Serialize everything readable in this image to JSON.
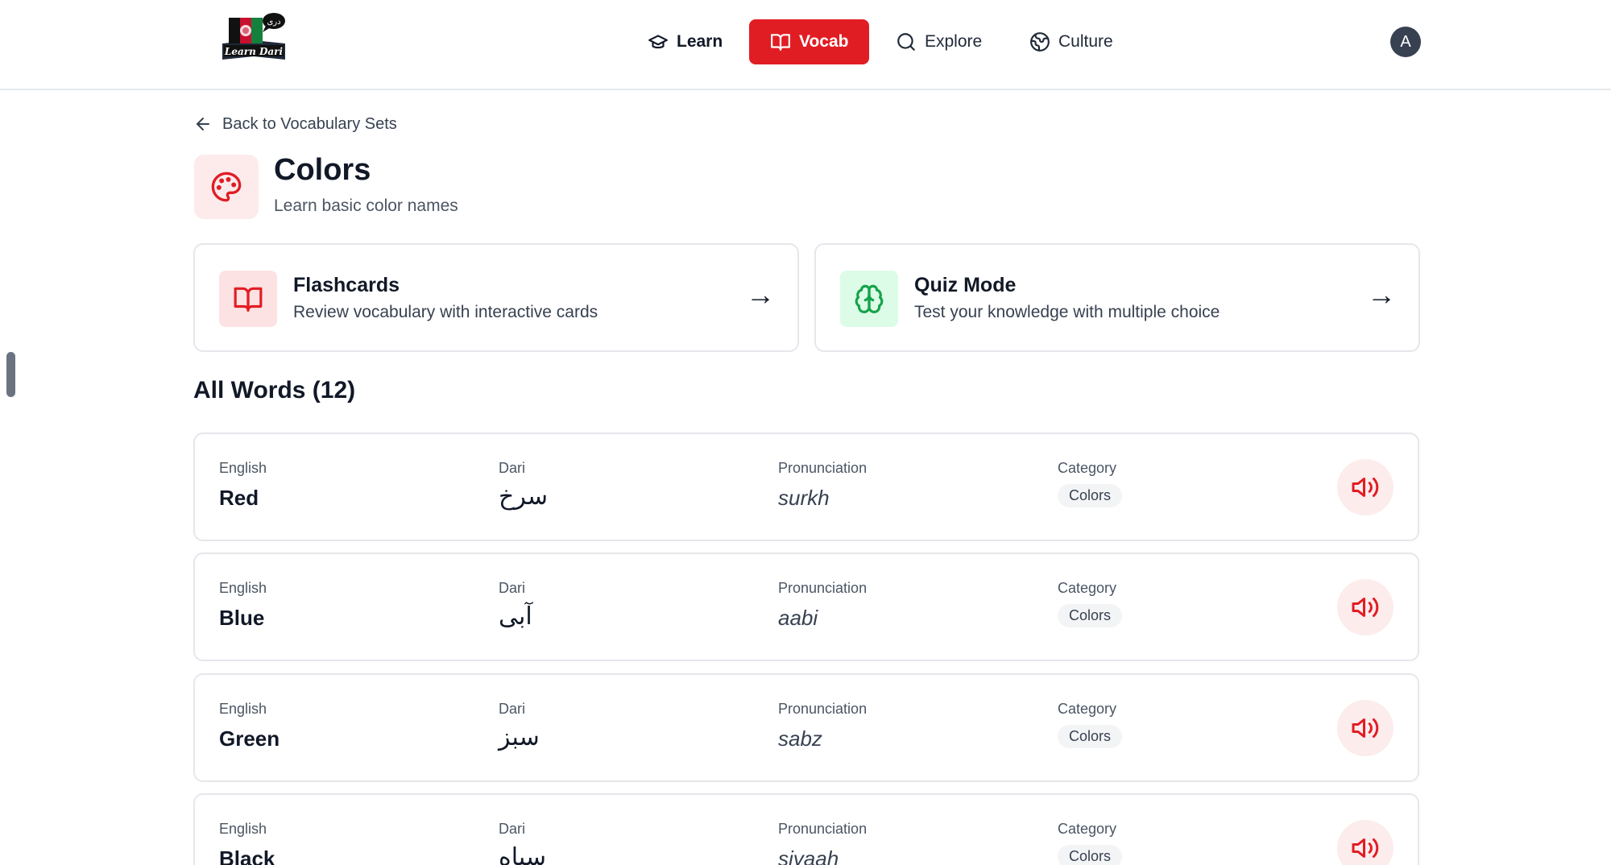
{
  "header": {
    "logo": {
      "text_badge": "دری",
      "wordmark": "Learn Dari"
    },
    "nav": [
      {
        "label": "Learn",
        "icon": "graduation-cap-icon"
      },
      {
        "label": "Vocab",
        "icon": "book-open-icon",
        "active": true
      },
      {
        "label": "Explore",
        "icon": "search-icon"
      },
      {
        "label": "Culture",
        "icon": "globe-icon"
      }
    ],
    "avatar_initial": "A"
  },
  "back_link": "Back to Vocabulary Sets",
  "set": {
    "title": "Colors",
    "subtitle": "Learn basic color names",
    "icon": "palette-icon"
  },
  "modes": [
    {
      "title": "Flashcards",
      "description": "Review vocabulary with interactive cards",
      "icon": "book-open-icon",
      "arrow": "→"
    },
    {
      "title": "Quiz Mode",
      "description": "Test your knowledge with multiple choice",
      "icon": "brain-icon",
      "arrow": "→"
    }
  ],
  "section_title": "All Words (12)",
  "columns": {
    "english": "English",
    "dari": "Dari",
    "pronunciation": "Pronunciation",
    "category": "Category"
  },
  "words": [
    {
      "english": "Red",
      "dari": "سرخ",
      "pronunciation": "surkh",
      "category": "Colors"
    },
    {
      "english": "Blue",
      "dari": "آبی",
      "pronunciation": "aabi",
      "category": "Colors"
    },
    {
      "english": "Green",
      "dari": "سبز",
      "pronunciation": "sabz",
      "category": "Colors"
    },
    {
      "english": "Black",
      "dari": "سیاه",
      "pronunciation": "siyaah",
      "category": "Colors"
    }
  ],
  "colors": {
    "accent": "#e11d24",
    "accent_light": "#fdebec",
    "quiz_green": "#16a34a",
    "quiz_green_light": "#dcfce7",
    "border": "#e5e7eb"
  }
}
